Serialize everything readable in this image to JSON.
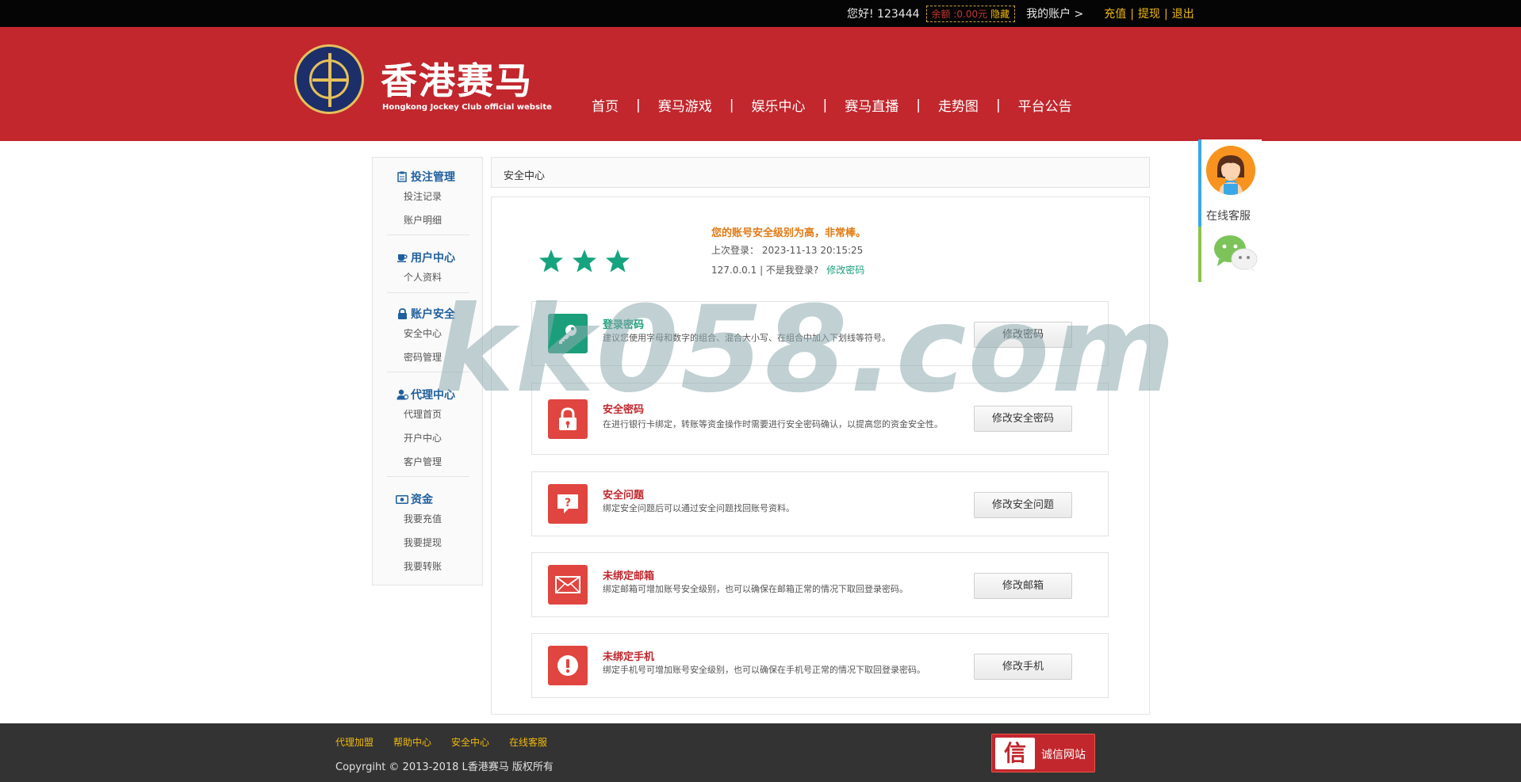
{
  "topbar": {
    "greeting": "您好! 123444",
    "balance": "余额 :0.00元",
    "hide": "隐藏",
    "account": "我的账户 >",
    "recharge": "充值",
    "withdraw": "提现",
    "logout": "退出",
    "sep": "|"
  },
  "brand": {
    "title": "香港赛马",
    "subtitle": "Hongkong Jockey Club official website"
  },
  "nav": {
    "sep": "|",
    "items": [
      "首页",
      "赛马游戏",
      "娱乐中心",
      "赛马直播",
      "走势图",
      "平台公告"
    ]
  },
  "sidebar": {
    "groups": [
      {
        "title": "投注管理",
        "icon": "clipboard-icon",
        "links": [
          "投注记录",
          "账户明细"
        ]
      },
      {
        "title": "用户中心",
        "icon": "cup-icon",
        "links": [
          "个人资料"
        ]
      },
      {
        "title": "账户安全",
        "icon": "lock-icon",
        "links": [
          "安全中心",
          "密码管理"
        ]
      },
      {
        "title": "代理中心",
        "icon": "agent-icon",
        "links": [
          "代理首页",
          "开户中心",
          "客户管理"
        ]
      },
      {
        "title": "资金",
        "icon": "money-icon",
        "links": [
          "我要充值",
          "我要提现",
          "我要转账"
        ]
      }
    ]
  },
  "main": {
    "breadcrumb": "安全中心",
    "security": {
      "stars": 3,
      "level_text": "您的账号安全级别为高，非常棒。",
      "last_login": "上次登录： 2023-11-13 20:15:25",
      "ip": "127.0.0.1 | 不是我登录?",
      "change_password_link": "修改密码"
    },
    "rows": [
      {
        "icon": "key-icon",
        "color": "#1a9f7a",
        "title": "登录密码",
        "title_color": "#1a9f7a",
        "desc": "建议您使用字母和数字的组合、混合大小写、在组合中加入下划线等符号。",
        "button": "修改密码"
      },
      {
        "icon": "lock-icon",
        "color": "#e0453f",
        "title": "安全密码",
        "title_color": "#c1272d",
        "desc": "在进行银行卡绑定，转账等资金操作时需要进行安全密码确认，以提高您的资金安全性。",
        "button": "修改安全密码"
      },
      {
        "icon": "question-icon",
        "color": "#e0453f",
        "title": "安全问题",
        "title_color": "#c1272d",
        "desc": "绑定安全问题后可以通过安全问题找回账号资料。",
        "button": "修改安全问题"
      },
      {
        "icon": "mail-icon",
        "color": "#e0453f",
        "title": "未绑定邮箱",
        "title_color": "#c1272d",
        "desc": "绑定邮箱可增加账号安全级别，也可以确保在邮箱正常的情况下取回登录密码。",
        "button": "修改邮箱"
      },
      {
        "icon": "alert-icon",
        "color": "#e0453f",
        "title": "未绑定手机",
        "title_color": "#c1272d",
        "desc": "绑定手机号可增加账号安全级别，也可以确保在手机号正常的情况下取回登录密码。",
        "button": "修改手机"
      }
    ]
  },
  "float_service": {
    "label": "在线客服"
  },
  "footer": {
    "links": [
      "代理加盟",
      "帮助中心",
      "安全中心",
      "在线客服"
    ],
    "copyright": "Copyrgiht © 2013-2018 L香港赛马 版权所有",
    "trust_mark": "信",
    "trust_text": "诚信网站"
  },
  "watermark": "kk058.com"
}
